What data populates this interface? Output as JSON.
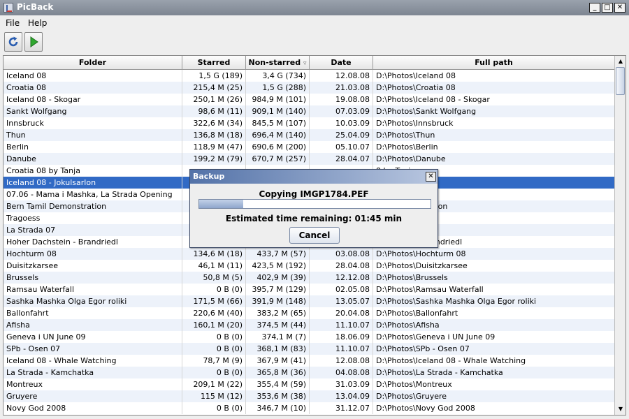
{
  "window": {
    "title": "PicBack",
    "minimize": "_",
    "maximize": "□",
    "close": "✕"
  },
  "menu": [
    "File",
    "Help"
  ],
  "toolbar": {
    "refresh": "refresh-icon",
    "run": "play-icon"
  },
  "table": {
    "columns": [
      "Folder",
      "Starred",
      "Non-starred",
      "Date",
      "Full path"
    ],
    "sort_indicator": "▿",
    "selected_index": 9,
    "rows": [
      [
        "Iceland 08",
        "1,5 G (189)",
        "3,4 G (734)",
        "12.08.08",
        "D:\\Photos\\Iceland 08"
      ],
      [
        "Croatia 08",
        "215,4 M (25)",
        "1,5 G (288)",
        "21.03.08",
        "D:\\Photos\\Croatia 08"
      ],
      [
        "Iceland 08 - Skogar",
        "250,1 M (26)",
        "984,9 M (101)",
        "19.08.08",
        "D:\\Photos\\Iceland 08 - Skogar"
      ],
      [
        "Sankt Wolfgang",
        "98,6 M (11)",
        "909,1 M (140)",
        "07.03.09",
        "D:\\Photos\\Sankt Wolfgang"
      ],
      [
        "Innsbruck",
        "322,6 M (34)",
        "845,5 M (107)",
        "10.03.09",
        "D:\\Photos\\Innsbruck"
      ],
      [
        "Thun",
        "136,8 M (18)",
        "696,4 M (140)",
        "25.04.09",
        "D:\\Photos\\Thun"
      ],
      [
        "Berlin",
        "118,9 M (47)",
        "690,6 M (200)",
        "05.10.07",
        "D:\\Photos\\Berlin"
      ],
      [
        "Danube",
        "199,2 M (79)",
        "670,7 M (257)",
        "28.04.07",
        "D:\\Photos\\Danube"
      ],
      [
        "Croatia 08 by Tanja",
        "",
        "",
        "",
        "8 by Tanja"
      ],
      [
        "Iceland 08 - Jokulsarlon",
        "",
        "",
        "",
        "8 - Jokulsarlon"
      ],
      [
        "07.06 - Mama i Mashka, La Strada Opening",
        "",
        "",
        "",
        "Strada Opening"
      ],
      [
        "Bern Tamil Demonstration",
        "",
        "",
        "",
        "mil Demonstration"
      ],
      [
        "Tragoess",
        "",
        "",
        "",
        "s"
      ],
      [
        "La Strada 07",
        "",
        "",
        "",
        "a 07"
      ],
      [
        "Hoher Dachstein - Brandriedl",
        "",
        "",
        "",
        "Dachstein - Brandriedl"
      ],
      [
        "Hochturm 08",
        "134,6 M (18)",
        "433,7 M (57)",
        "03.08.08",
        "D:\\Photos\\Hochturm 08"
      ],
      [
        "Duisitzkarsee",
        "46,1 M (11)",
        "423,5 M (192)",
        "28.04.08",
        "D:\\Photos\\Duisitzkarsee"
      ],
      [
        "Brussels",
        "50,8 M (5)",
        "402,9 M (39)",
        "12.12.08",
        "D:\\Photos\\Brussels"
      ],
      [
        "Ramsau Waterfall",
        "0 B (0)",
        "395,7 M (129)",
        "02.05.08",
        "D:\\Photos\\Ramsau Waterfall"
      ],
      [
        "Sashka Mashka Olga Egor roliki",
        "171,5 M (66)",
        "391,9 M (148)",
        "13.05.07",
        "D:\\Photos\\Sashka Mashka Olga Egor roliki"
      ],
      [
        "Ballonfahrt",
        "220,6 M (40)",
        "383,2 M (65)",
        "20.04.08",
        "D:\\Photos\\Ballonfahrt"
      ],
      [
        "Afisha",
        "160,1 M (20)",
        "374,5 M (44)",
        "11.10.07",
        "D:\\Photos\\Afisha"
      ],
      [
        "Geneva i UN June 09",
        "0 B (0)",
        "374,1 M (7)",
        "18.06.09",
        "D:\\Photos\\Geneva i UN June 09"
      ],
      [
        "SPb - Osen 07",
        "0 B (0)",
        "368,1 M (83)",
        "11.10.07",
        "D:\\Photos\\SPb - Osen 07"
      ],
      [
        "Iceland 08 - Whale Watching",
        "78,7 M (9)",
        "367,9 M (41)",
        "12.08.08",
        "D:\\Photos\\Iceland 08 - Whale Watching"
      ],
      [
        "La Strada - Kamchatka",
        "0 B (0)",
        "365,8 M (36)",
        "04.08.08",
        "D:\\Photos\\La Strada - Kamchatka"
      ],
      [
        "Montreux",
        "209,1 M (22)",
        "355,4 M (59)",
        "31.03.09",
        "D:\\Photos\\Montreux"
      ],
      [
        "Gruyere",
        "115 M (12)",
        "353,6 M (38)",
        "13.04.09",
        "D:\\Photos\\Gruyere"
      ],
      [
        "Novy God 2008",
        "0 B (0)",
        "346,7 M (10)",
        "31.12.07",
        "D:\\Photos\\Novy God 2008"
      ]
    ]
  },
  "dialog": {
    "title": "Backup",
    "close": "✕",
    "copying": "Copying IMGP1784.PEF",
    "progress": 0.19,
    "eta": "Estimated time remaining: 01:45 min",
    "cancel": "Cancel"
  },
  "scrollbar": {
    "up": "▲",
    "down": "▼"
  },
  "colors": {
    "selection": "#316ac5",
    "stripe": "#edf2fa"
  }
}
